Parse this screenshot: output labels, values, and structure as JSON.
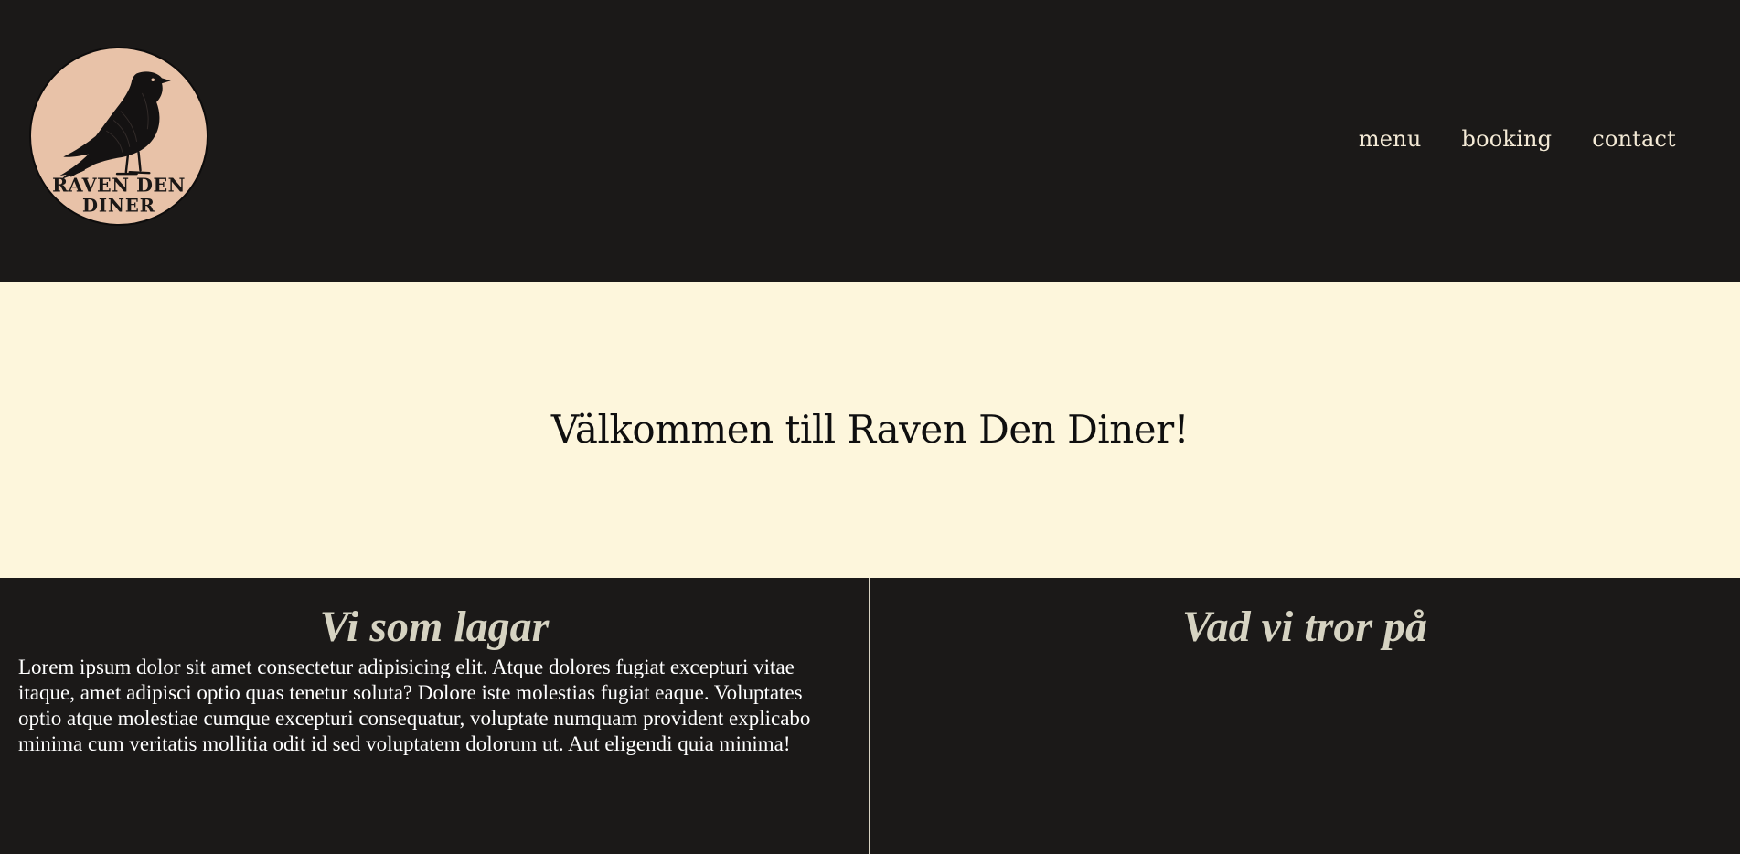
{
  "header": {
    "logo": {
      "text_line1": "RAVEN DEN",
      "text_line2": "DINER",
      "icon": "raven-icon",
      "bg_color": "#e8c2a8"
    },
    "nav": {
      "menu_label": "menu",
      "booking_label": "booking",
      "contact_label": "contact"
    },
    "bg_color": "#1b1918"
  },
  "hero": {
    "title": "Välkommen till Raven Den Diner!",
    "bg_color": "#fdf6dc"
  },
  "columns": {
    "left": {
      "heading": "Vi som lagar",
      "body": "Lorem ipsum dolor sit amet consectetur adipisicing elit. Atque dolores fugiat excepturi vitae itaque, amet adipisci optio quas tenetur soluta? Dolore iste molestias fugiat eaque. Voluptates optio atque molestiae cumque excepturi consequatur, voluptate numquam provident explicabo minima cum veritatis mollitia odit id sed voluptatem dolorum ut. Aut eligendi quia minima!"
    },
    "right": {
      "heading": "Vad vi tror på"
    },
    "heading_color": "#d6d3c2"
  }
}
